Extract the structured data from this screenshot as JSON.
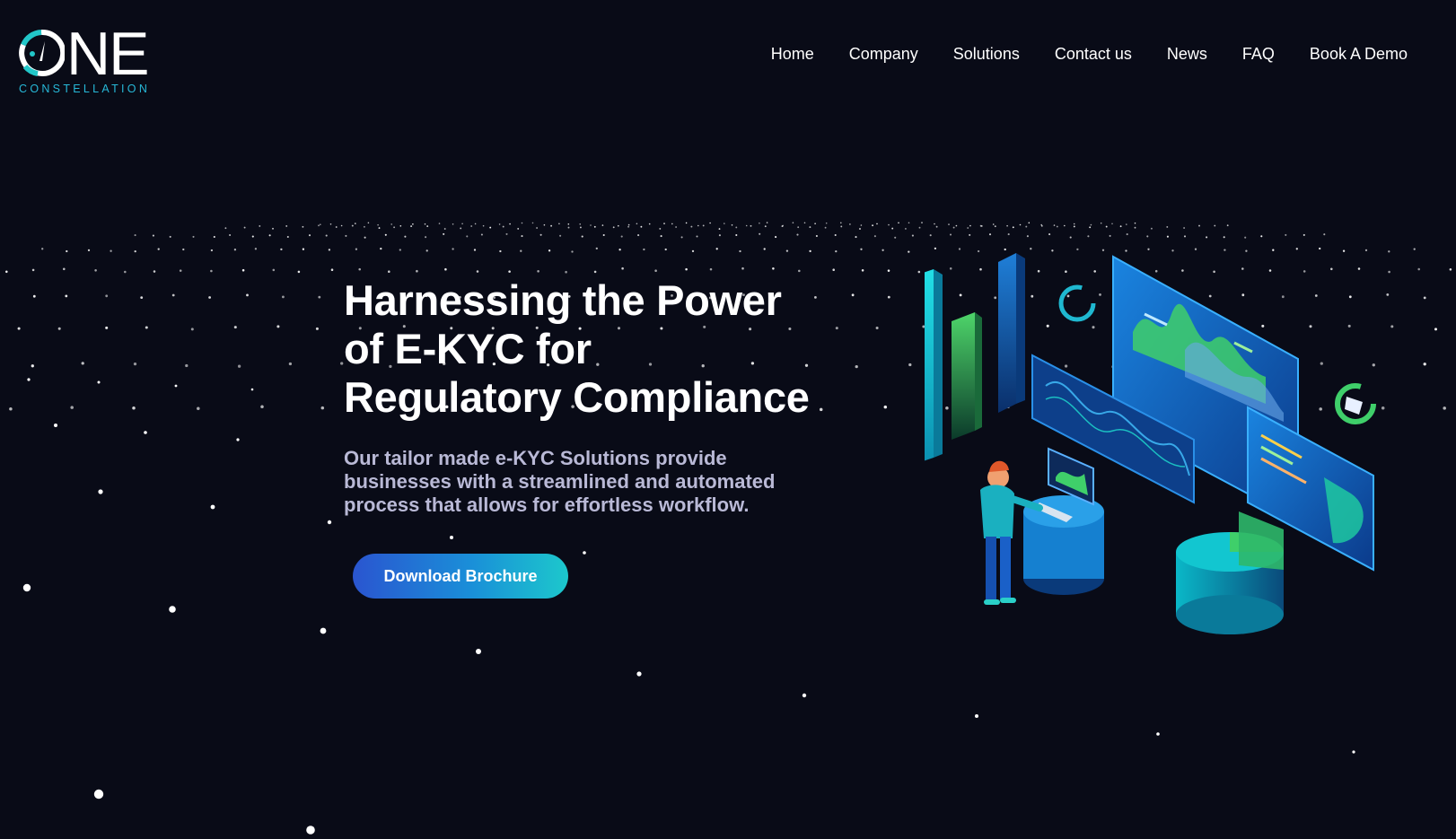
{
  "brand": {
    "logo_text": "ONE",
    "tagline": "CONSTELLATION"
  },
  "nav": {
    "items": [
      {
        "label": "Home"
      },
      {
        "label": "Company"
      },
      {
        "label": "Solutions"
      },
      {
        "label": "Contact us"
      },
      {
        "label": "News"
      },
      {
        "label": "FAQ"
      },
      {
        "label": "Book A Demo"
      }
    ]
  },
  "hero": {
    "title_lines": [
      "Harnessing the Power",
      "of E-KYC for",
      "Regulatory Compliance"
    ],
    "description_lines": [
      "Our tailor made e-KYC Solutions provide",
      "businesses with a streamlined and automated",
      "process that allows for effortless workflow."
    ],
    "cta_label": "Download Brochure"
  },
  "colors": {
    "background": "#090b17",
    "accent_teal": "#1cc8cc",
    "accent_blue": "#2a55d0",
    "logo_sub": "#27b8d8",
    "description_text": "#b9b9d6"
  },
  "icons": {
    "illustration": "ekyc-dashboard-illustration",
    "starfield": "starfield-background"
  }
}
